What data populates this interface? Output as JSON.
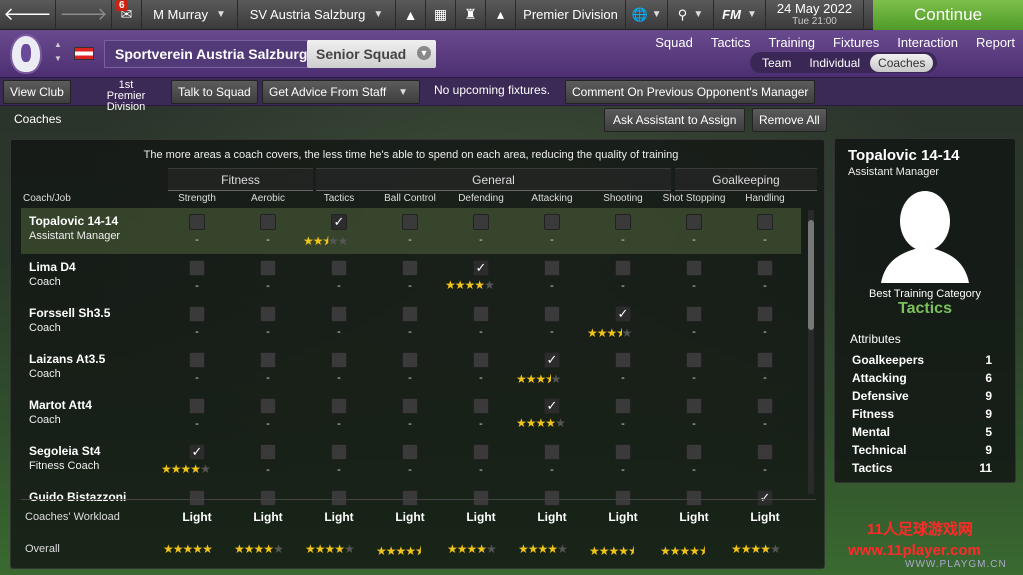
{
  "topbar": {
    "inbox_badge": "6",
    "manager_name": "M Murray",
    "club_name": "SV Austria Salzburg",
    "competition": "Premier Division",
    "fm_logo": "FM",
    "date": "24 May 2022",
    "day_time": "Tue 21:00",
    "continue_label": "Continue"
  },
  "club": {
    "full_name": "Sportverein Austria Salzburg",
    "squad": "Senior Squad",
    "nav": [
      "Squad",
      "Tactics",
      "Training",
      "Fixtures",
      "Interaction",
      "Report"
    ],
    "subtabs": [
      "Team",
      "Individual",
      "Coaches"
    ]
  },
  "actions": {
    "view_club": "View Club",
    "position": "1st",
    "position_league": "Premier Division",
    "talk_to_squad": "Talk to Squad",
    "get_advice": "Get Advice From Staff",
    "fixtures_text": "No upcoming fixtures.",
    "comment_opponent": "Comment On Previous Opponent's Manager"
  },
  "section": {
    "title": "Coaches",
    "ask_assistant": "Ask Assistant to Assign",
    "remove_all": "Remove All",
    "info": "The more areas a coach covers, the less time he's able to spend on each area, reducing the quality of training"
  },
  "groups": {
    "fitness": "Fitness",
    "general": "General",
    "goalkeeping": "Goalkeeping"
  },
  "columns": {
    "coach_job": "Coach/Job",
    "areas": [
      "Strength",
      "Aerobic",
      "Tactics",
      "Ball Control",
      "Defending",
      "Attacking",
      "Shooting",
      "Shot Stopping",
      "Handling"
    ]
  },
  "coaches": [
    {
      "name": "Topalovic 14-14",
      "job": "Assistant Manager",
      "area": 2,
      "stars": 2.5
    },
    {
      "name": "Lima D4",
      "job": "Coach",
      "area": 4,
      "stars": 4
    },
    {
      "name": "Forssell Sh3.5",
      "job": "Coach",
      "area": 6,
      "stars": 3.5
    },
    {
      "name": "Laizans At3.5",
      "job": "Coach",
      "area": 5,
      "stars": 3.5
    },
    {
      "name": "Martot Att4",
      "job": "Coach",
      "area": 5,
      "stars": 4
    },
    {
      "name": "Segoleia St4",
      "job": "Fitness Coach",
      "area": 0,
      "stars": 4
    },
    {
      "name": "Guido Bistazzoni",
      "job": "",
      "area": 8,
      "stars": 0
    }
  ],
  "footer": {
    "workload_label": "Coaches' Workload",
    "overall_label": "Overall",
    "workload": [
      "Light",
      "Light",
      "Light",
      "Light",
      "Light",
      "Light",
      "Light",
      "Light",
      "Light"
    ],
    "overall_stars": [
      5,
      4,
      4,
      4.5,
      4,
      4,
      4.5,
      4.5,
      4
    ]
  },
  "profile": {
    "name": "Topalovic 14-14",
    "job": "Assistant Manager",
    "best_label": "Best Training Category",
    "best_category": "Tactics",
    "attributes_label": "Attributes",
    "attributes": [
      {
        "name": "Goalkeepers",
        "value": "1"
      },
      {
        "name": "Attacking",
        "value": "6"
      },
      {
        "name": "Defensive",
        "value": "9"
      },
      {
        "name": "Fitness",
        "value": "9"
      },
      {
        "name": "Mental",
        "value": "5"
      },
      {
        "name": "Technical",
        "value": "9"
      },
      {
        "name": "Tactics",
        "value": "11"
      }
    ]
  },
  "watermark": {
    "line1": "11人足球游戏网",
    "line2": "www.11player.com",
    "line3": "WWW.PLAYGM.CN"
  }
}
